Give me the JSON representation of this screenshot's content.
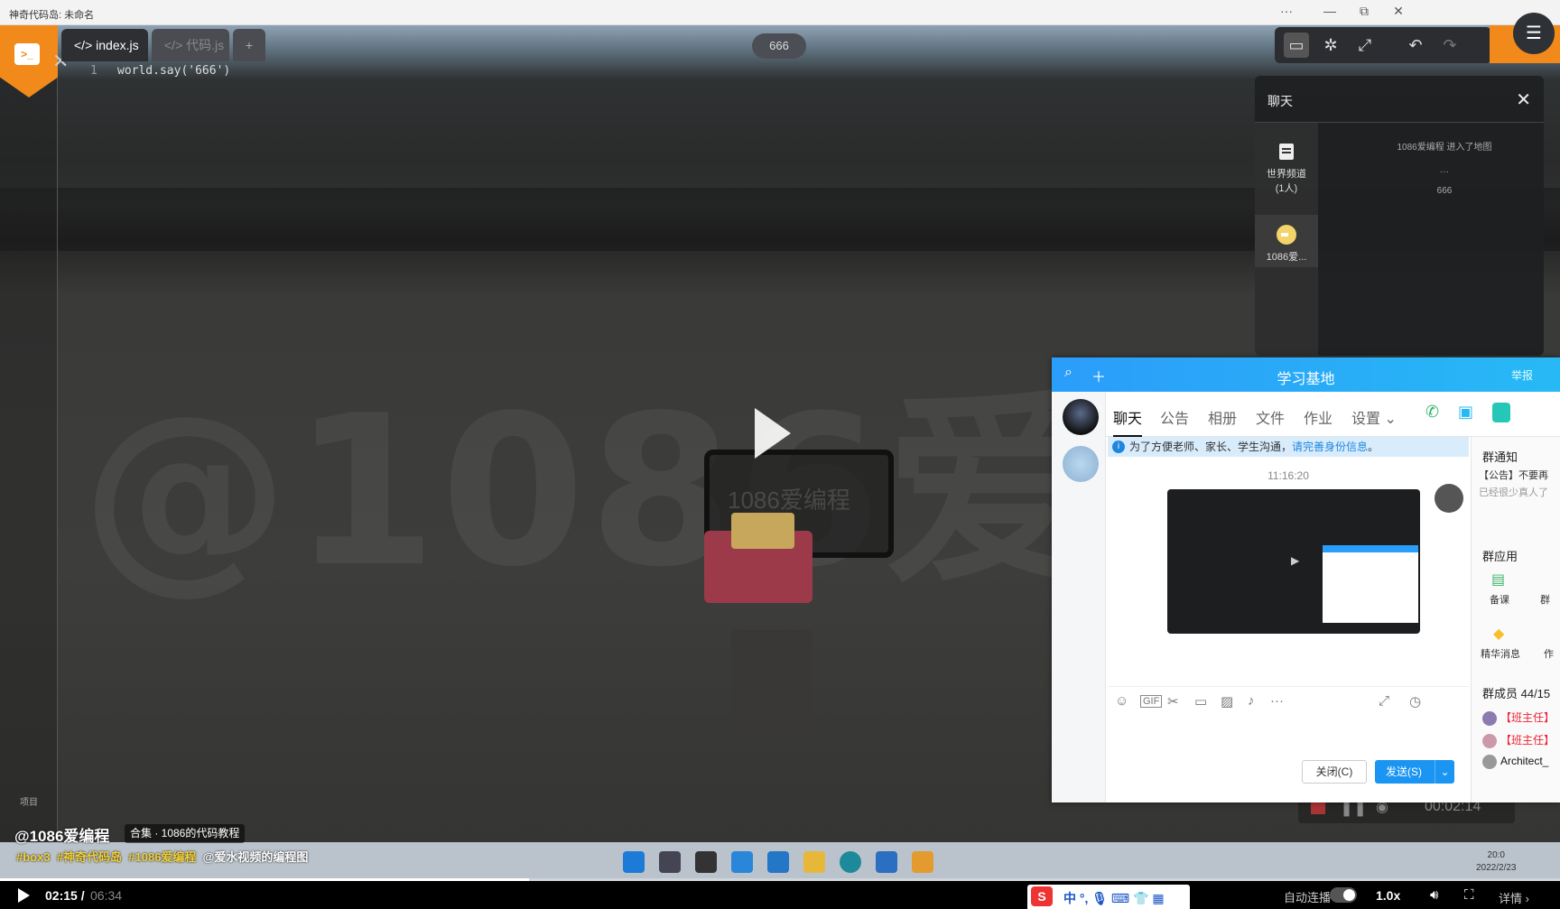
{
  "window": {
    "title": "神奇代码岛: 未命名",
    "more": "···",
    "minimize": "—",
    "maximize": "⧉",
    "close": "✕"
  },
  "editor": {
    "tabs": [
      {
        "label": "</> index.js"
      },
      {
        "label": "</> 代码.js"
      }
    ],
    "add_tab": "+",
    "line_number": "1",
    "code": "world.say('666')"
  },
  "scene": {
    "score_pill": "666",
    "watermark": "@1086爱编程",
    "sign_text": "1086爱编程"
  },
  "toolbar": {
    "icons": [
      "chat-icon",
      "bug-icon",
      "expand-icon",
      "undo-icon",
      "redo-icon"
    ],
    "menu": "☰"
  },
  "game_chat": {
    "title": "聊天",
    "close": "✕",
    "channels": [
      {
        "name": "世界频道",
        "count": "(1人)"
      },
      {
        "name": "1086爱..."
      }
    ],
    "messages": [
      "1086爱编程 进入了地图",
      "···",
      "666"
    ]
  },
  "qq": {
    "title": "学习基地",
    "report": "举报",
    "tabs": [
      "聊天",
      "公告",
      "相册",
      "文件",
      "作业",
      "设置 ⌄"
    ],
    "notice_text": "为了方便老师、家长、学生沟通，",
    "notice_link": "请完善身份信息",
    "notice_end": "。",
    "time": "11:16:20",
    "close_btn": "关闭(C)",
    "send_btn": "发送(S)",
    "send_dd": "⌄",
    "right": {
      "notice_title": "群通知",
      "notice_line1": "【公告】不要再",
      "notice_line2": "已经很少真人了",
      "apps_title": "群应用",
      "apps": [
        "备课",
        "群",
        "精华消息",
        "作"
      ],
      "members_title": "群成员 44/15",
      "members": [
        "【班主任】",
        "【班主任】",
        "Architect_"
      ]
    }
  },
  "recorder": {
    "time": "00:02:14"
  },
  "taskbar": {
    "time": "20:0",
    "date": "2022/2/23"
  },
  "video": {
    "author": "@1086爱编程",
    "collection": "合集 · 1086的代码教程",
    "tags": [
      "#box3",
      "#神奇代码岛",
      "#1086爱编程"
    ],
    "mention": "@爱水视频的编程图",
    "progress": 0.339,
    "current_time": "02:15 /",
    "total_time": "06:34",
    "ime_label": "中 °, 🎙 ⌨ 👕 ▦",
    "autoplay": "自动连播",
    "speed": "1.0x",
    "detail": "详情 ›",
    "project_label": "项目"
  }
}
